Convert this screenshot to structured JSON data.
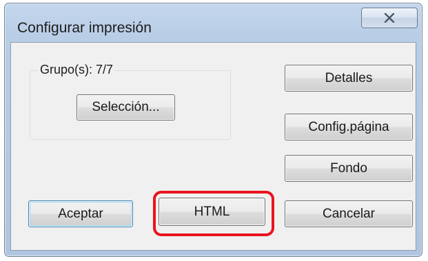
{
  "window": {
    "title": "Configurar impresión",
    "close_icon": "close-x-icon"
  },
  "group": {
    "label": "Grupo(s): 7/7",
    "selection_button": "Selección..."
  },
  "buttons": {
    "details": "Detalles",
    "page_setup": "Config.página",
    "background": "Fondo",
    "accept": "Aceptar",
    "html": "HTML",
    "cancel": "Cancelar"
  },
  "annotation": {
    "highlight_color": "#e8141e",
    "highlight_target": "html-button"
  }
}
